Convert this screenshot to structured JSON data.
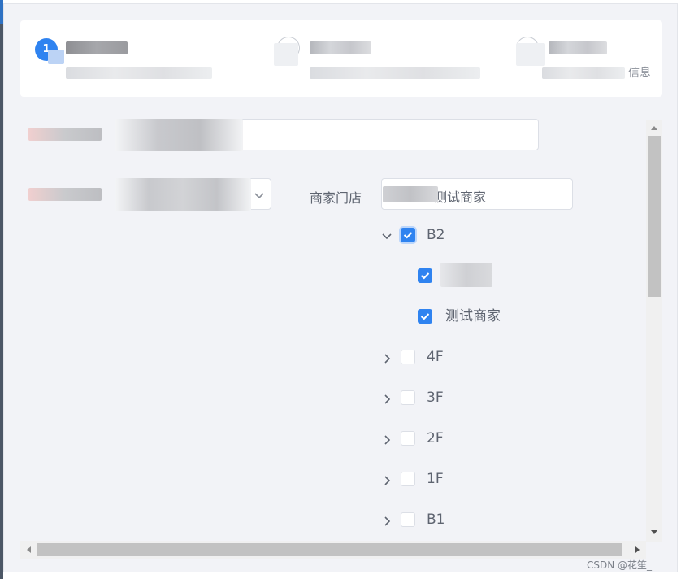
{
  "steps": {
    "step1_number": "1",
    "end_text": "信息"
  },
  "form": {
    "store_label": "商家门店",
    "store_value_suffix": "测试商家"
  },
  "tree": [
    {
      "label": "B2",
      "checked": true,
      "expanded": true,
      "level": 0
    },
    {
      "label": "",
      "checked": true,
      "level": 1
    },
    {
      "label": "测试商家",
      "checked": true,
      "level": 1
    },
    {
      "label": "4F",
      "checked": false,
      "expanded": false,
      "level": 0
    },
    {
      "label": "3F",
      "checked": false,
      "expanded": false,
      "level": 0
    },
    {
      "label": "2F",
      "checked": false,
      "expanded": false,
      "level": 0
    },
    {
      "label": "1F",
      "checked": false,
      "expanded": false,
      "level": 0
    },
    {
      "label": "B1",
      "checked": false,
      "expanded": false,
      "level": 0
    }
  ],
  "watermark": "CSDN @花笙_",
  "colors": {
    "accent": "#2f83f0",
    "background": "#f2f3f7",
    "text": "#5e6470"
  }
}
